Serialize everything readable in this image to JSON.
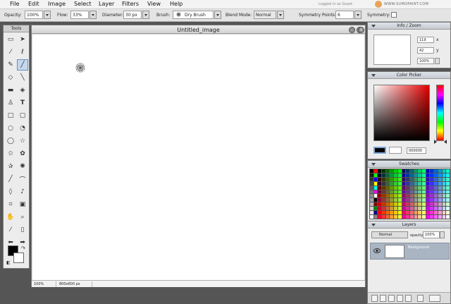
{
  "menu": [
    "File",
    "Edit",
    "Image",
    "Select",
    "Layer",
    "Filters",
    "View",
    "Help"
  ],
  "account": {
    "status": "Logged in as Guest",
    "brand": "WWW.SUMOPAINT.COM"
  },
  "options": {
    "opacity_label": "Opacity:",
    "opacity_value": "100%",
    "flow_label": "Flow:",
    "flow_value": "33%",
    "diameter_label": "Diameter:",
    "diameter_value": "30 px",
    "brush_label": "Brush:",
    "brush_value": "Dry Brush",
    "blend_label": "Blend Mode:",
    "blend_value": "Normal",
    "symmetry_points_label": "Symmetry Points:",
    "symmetry_points_value": "6",
    "symmetry_label": "Symmetry:"
  },
  "tools": {
    "title": "Tools"
  },
  "document": {
    "title": "Untitled_image",
    "zoom": "100%",
    "size": "800x600 px"
  },
  "info": {
    "title": "Info / Zoom",
    "x": "119",
    "y": "42",
    "zoom": "100%",
    "x_label": "x",
    "y_label": "y"
  },
  "color_picker": {
    "title": "Color Picker",
    "hex": "000000",
    "current_color": "#000000",
    "previous_color": "#ffffff"
  },
  "swatches": {
    "title": "Swatches"
  },
  "layers": {
    "title": "Layers",
    "blend": "Normal",
    "opacity_label": "opacity",
    "opacity": "100%",
    "items": [
      {
        "name": "Background"
      }
    ]
  }
}
